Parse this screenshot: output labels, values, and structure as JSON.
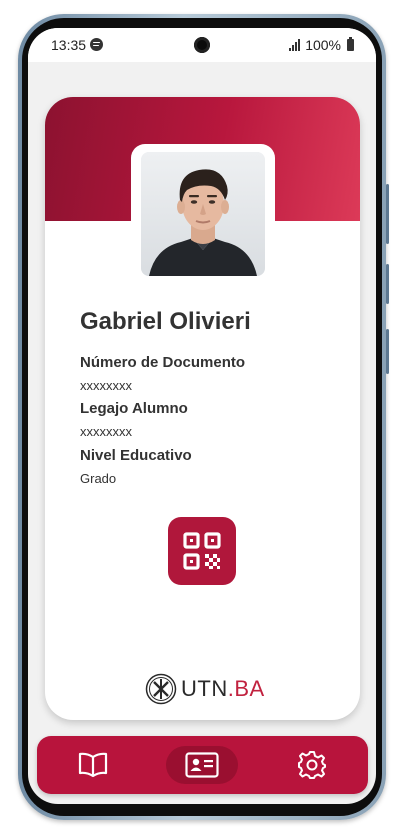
{
  "status_bar": {
    "time": "13:35",
    "battery_percent": "100%"
  },
  "profile": {
    "name": "Gabriel Olivieri",
    "fields": [
      {
        "label": "Número de Documento",
        "value": "xxxxxxxx"
      },
      {
        "label": "Legajo Alumno",
        "value": "xxxxxxxx"
      },
      {
        "label": "Nivel Educativo",
        "value": "Grado"
      }
    ]
  },
  "logo": {
    "text_main": "UTN",
    "text_accent": ".BA"
  },
  "bottom_nav": {
    "items": [
      {
        "icon": "book-icon",
        "active": false
      },
      {
        "icon": "id-card-icon",
        "active": true
      },
      {
        "icon": "gear-icon",
        "active": false
      }
    ]
  },
  "colors": {
    "brand_red": "#b8143c",
    "header_gradient_start": "#8c1230",
    "header_gradient_end": "#dc3a58",
    "screen_bg": "#f1f1f1"
  }
}
